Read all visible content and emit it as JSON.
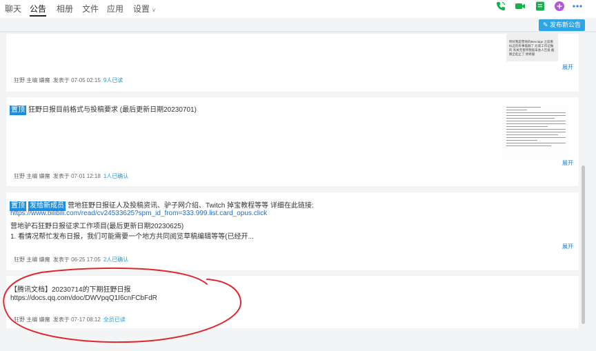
{
  "tabs": [
    {
      "label": "聊天"
    },
    {
      "label": "公告"
    },
    {
      "label": "相册"
    },
    {
      "label": "文件"
    },
    {
      "label": "应用"
    },
    {
      "label": "设置"
    }
  ],
  "colors": {
    "accent": "#2ea6e6",
    "tag": "#1a8ee0",
    "link": "#1b6fd0",
    "annotation": "#e0262c"
  },
  "publish_button": "发布新公告",
  "expand_label": "展开",
  "posts": [
    {
      "thumb_text": "所好我是营地的Bevridge 之前看似这的有事着群了 比第工作记做的 有关无害所我股未会人告竟 截稿全起止了 修修服",
      "author": "狂野 主编 嫌魔",
      "posted": "发表于 07-05 02:15",
      "count": "9人已读"
    },
    {
      "tag": "置顶",
      "title": "狂野日报目前格式与投稿要求 (最后更新日期20230701)",
      "author": "狂野 主编 嫌魔",
      "posted": "发表于 07-01 12:18",
      "count": "1人已确认"
    },
    {
      "tag1": "置顶",
      "tag2": "发给新成员",
      "line1": "营地狂野日报征人及投稿资讯、驴子网介绍、Twitch 掉宝教程等等 详细在此链接:",
      "line2": "https://www.bilibili.com/read/cv24533625?spm_id_from=333.999.list.card_opus.click",
      "line3": "营地驴石狂野日报征求工作项目(最后更新日期20230625)",
      "line4": "1. 看情况帮忙发布日报，我们可能需要一个地方共同阅览草稿编辑等等(已经开...",
      "author": "狂野 主编 嫌魔",
      "posted": "发表于 06-25 17:05",
      "count": "2人已确认"
    },
    {
      "line1": "【腾讯文档】20230714的下期狂野日报",
      "line2": "https://docs.qq.com/doc/DWVpqQ1I6cnFCbFdR",
      "author": "狂野 主编 嫌魔",
      "posted": "发表于 07-17 08:12",
      "count": "全员已读"
    }
  ]
}
